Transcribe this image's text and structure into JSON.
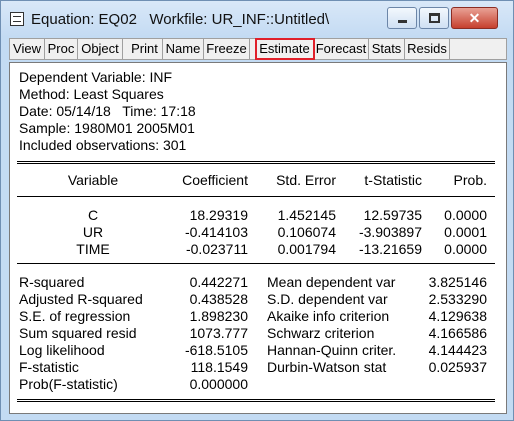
{
  "window": {
    "title": "Equation: EQ02   Workfile: UR_INF::Untitled\\",
    "close_glyph": "✕"
  },
  "toolbar": {
    "buttons": [
      "View",
      "Proc",
      "Object",
      "Print",
      "Name",
      "Freeze",
      "Estimate",
      "Forecast",
      "Stats",
      "Resids"
    ],
    "highlighted": "Estimate",
    "highlight_color": "#e0202a"
  },
  "header": {
    "dependent": "Dependent Variable: INF",
    "method": "Method: Least Squares",
    "date": "Date: 05/14/18   Time: 17:18",
    "sample": "Sample: 1980M01 2005M01",
    "obs": "Included observations: 301"
  },
  "table": {
    "columns": [
      "Variable",
      "Coefficient",
      "Std. Error",
      "t-Statistic",
      "Prob."
    ],
    "rows": [
      [
        "C",
        "18.29319",
        "1.452145",
        "12.59735",
        "0.0000"
      ],
      [
        "UR",
        "-0.414103",
        "0.106074",
        "-3.903897",
        "0.0001"
      ],
      [
        "TIME",
        "-0.023711",
        "0.001794",
        "-13.21659",
        "0.0000"
      ]
    ]
  },
  "stats": {
    "left": [
      [
        "R-squared",
        "0.442271"
      ],
      [
        "Adjusted R-squared",
        "0.438528"
      ],
      [
        "S.E. of regression",
        "1.898230"
      ],
      [
        "Sum squared resid",
        "1073.777"
      ],
      [
        "Log likelihood",
        "-618.5105"
      ],
      [
        "F-statistic",
        "118.1549"
      ],
      [
        "Prob(F-statistic)",
        "0.000000"
      ]
    ],
    "right": [
      [
        "Mean dependent var",
        "3.825146"
      ],
      [
        "S.D. dependent var",
        "2.533290"
      ],
      [
        "Akaike info criterion",
        "4.129638"
      ],
      [
        "Schwarz criterion",
        "4.166586"
      ],
      [
        "Hannan-Quinn criter.",
        "4.144423"
      ],
      [
        "Durbin-Watson stat",
        "0.025937"
      ]
    ]
  }
}
